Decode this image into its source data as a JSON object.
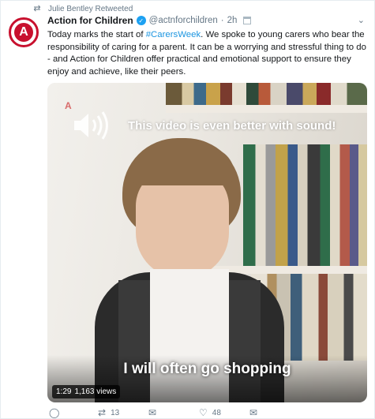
{
  "retweet": {
    "text": "Julie Bentley Retweeted"
  },
  "tweet": {
    "name": "Action for Children",
    "handle": "@actnforchildren",
    "separator": "·",
    "time": "2h",
    "avatar_letter": "A",
    "lines": [
      {
        "before": "Today marks the start of ",
        "hashtag": "#CarersWeek",
        "after": ". We spoke to young carers who bear the"
      },
      {
        "text": "responsibility of caring for a parent. It can be a worrying and stressful thing to do"
      },
      {
        "text": "- and Action for Children offer practical and emotional support to ensure they"
      },
      {
        "text": "enjoy and achieve, like their peers."
      }
    ]
  },
  "video": {
    "logo": "A",
    "sound_message": "This video is even better with sound!",
    "subtitle": "I will often go shopping",
    "duration": "1:29",
    "views": "1,163 views"
  },
  "actions": {
    "retweets": "13",
    "likes": "48"
  },
  "colors": {
    "brand_red": "#c8102e",
    "link_blue": "#1b95e0",
    "verified_blue": "#1da1f2"
  }
}
